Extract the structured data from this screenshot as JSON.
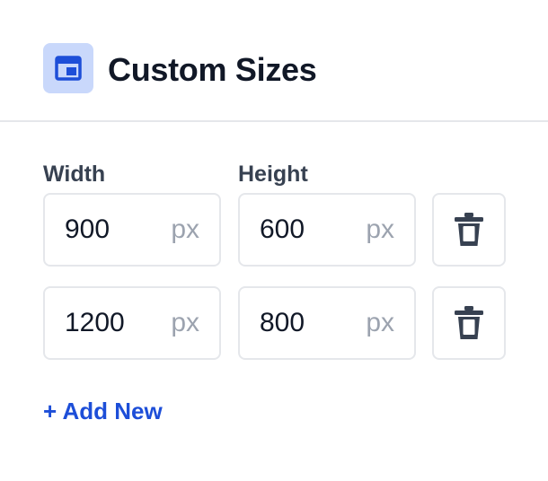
{
  "header": {
    "title": "Custom Sizes",
    "icon": "layout-icon",
    "icon_color": "#1d4ed8",
    "icon_bg": "#c9d8fb"
  },
  "columns": {
    "width_label": "Width",
    "height_label": "Height"
  },
  "rows": [
    {
      "width": "900",
      "width_unit": "px",
      "height": "600",
      "height_unit": "px"
    },
    {
      "width": "1200",
      "width_unit": "px",
      "height": "800",
      "height_unit": "px"
    }
  ],
  "delete_icon": "trash-icon",
  "add_new_label": "+ Add New",
  "accent_color": "#1d4ed8"
}
